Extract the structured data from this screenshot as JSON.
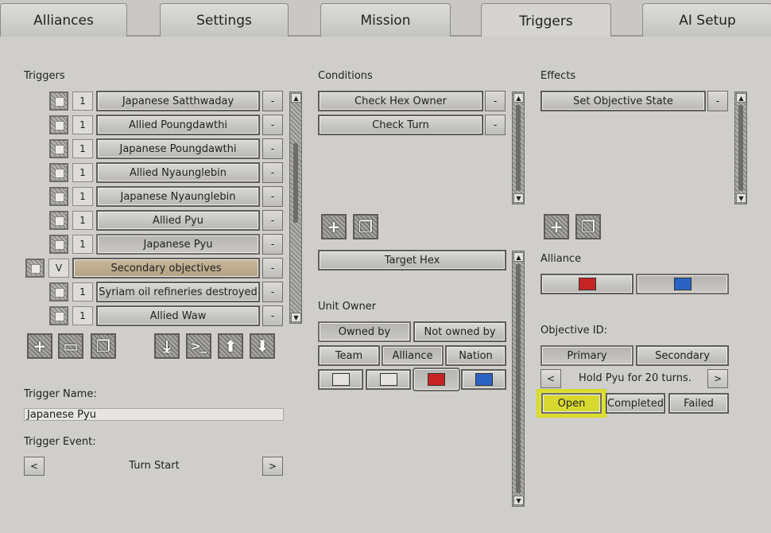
{
  "tabs": [
    "Alliances",
    "Settings",
    "Mission",
    "Triggers",
    "AI Setup"
  ],
  "triggers": {
    "header": "Triggers",
    "rows": [
      {
        "num": "1",
        "label": "Japanese Satthwaday"
      },
      {
        "num": "1",
        "label": "Allied Poungdawthi"
      },
      {
        "num": "1",
        "label": "Japanese Poungdawthi"
      },
      {
        "num": "1",
        "label": "Allied Nyaunglebin"
      },
      {
        "num": "1",
        "label": "Japanese Nyaunglebin"
      },
      {
        "num": "1",
        "label": "Allied Pyu"
      },
      {
        "num": "1",
        "label": "Japanese Pyu"
      },
      {
        "num": "V",
        "label": "Secondary objectives"
      },
      {
        "num": "1",
        "label": "Syriam oil refineries destroyed"
      },
      {
        "num": "1",
        "label": "Allied Waw"
      }
    ],
    "minus": "-",
    "toolbar_icons": [
      "add-icon",
      "folder-icon",
      "copy-icon",
      "import-icon",
      "console-icon",
      "move-up-icon",
      "move-down-icon"
    ],
    "name_label": "Trigger Name:",
    "name_value": "Japanese Pyu",
    "event_label": "Trigger Event:",
    "event_value": "Turn Start",
    "prev": "<",
    "next": ">"
  },
  "conditions": {
    "header": "Conditions",
    "items": [
      "Check Hex Owner",
      "Check Turn"
    ],
    "target_hex": "Target Hex",
    "unit_owner_label": "Unit Owner",
    "owned_by": "Owned by",
    "not_owned_by": "Not owned by",
    "scope": [
      "Team",
      "Alliance",
      "Nation"
    ],
    "color_options": [
      "#e4e3df",
      "#e4e3df",
      "#c62424",
      "#2a63c4"
    ]
  },
  "effects": {
    "header": "Effects",
    "items": [
      "Set Objective State"
    ],
    "alliance_label": "Alliance",
    "alliance_colors": [
      "#c62424",
      "#2a63c4"
    ],
    "objective_label": "Objective ID:",
    "primary": "Primary",
    "secondary": "Secondary",
    "objective_text": "Hold Pyu for 20 turns.",
    "states": [
      "Open",
      "Completed",
      "Failed"
    ],
    "highlight_color": "#d8dc24"
  },
  "scroll_up": "▲",
  "scroll_down": "▼"
}
